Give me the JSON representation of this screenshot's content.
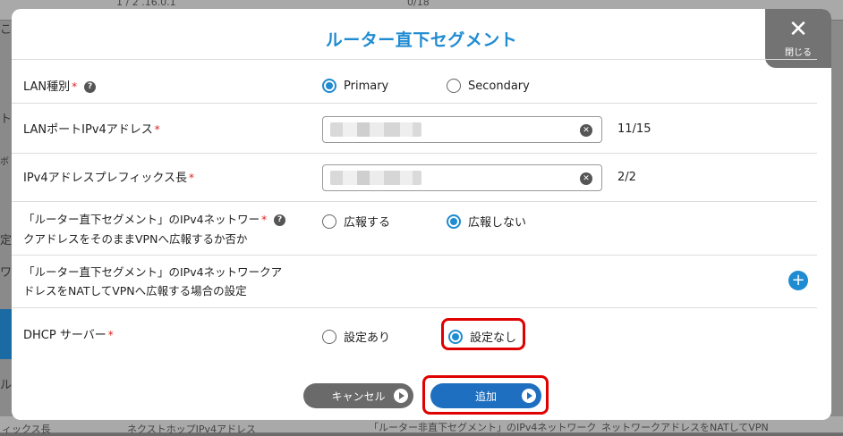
{
  "background": {
    "top_text": "0/18",
    "top_text_left": "1 / 2 .16.0.1",
    "bottom_texts": [
      "ィックス長",
      "ネクストホップIPv4アドレス",
      "「ルーター非直下セグメント」のIPv4ネットワーク",
      "ネットワークアドレスをNATしてVPN"
    ],
    "left_chars": [
      "こ",
      "ト",
      "ボ",
      "定",
      "ワ",
      "ル"
    ]
  },
  "modal": {
    "title": "ルーター直下セグメント",
    "close_icon": "close-icon",
    "close_label": "閉じる"
  },
  "form": {
    "lan_type": {
      "label": "LAN種別",
      "required": "*",
      "help": "?",
      "options": [
        "Primary",
        "Secondary"
      ],
      "selected": "Primary"
    },
    "lan_port_ipv4": {
      "label": "LANポートIPv4アドレス",
      "required": "*",
      "count": "11/15"
    },
    "ipv4_prefix": {
      "label": "IPv4アドレスプレフィックス長",
      "required": "*",
      "count": "2/2"
    },
    "advertise_vpn": {
      "label_line1": "「ルーター直下セグメント」のIPv4ネットワー",
      "label_line2": "クアドレスをそのままVPNへ広報するか否か",
      "required": "*",
      "help": "?",
      "options": [
        "広報する",
        "広報しない"
      ],
      "selected": "広報しない"
    },
    "nat_vpn": {
      "label_line1": "「ルーター直下セグメント」のIPv4ネットワークア",
      "label_line2": "ドレスをNATしてVPNへ広報する場合の設定",
      "add_icon": "+"
    },
    "dhcp": {
      "label": "DHCP サーバー",
      "required": "*",
      "options": [
        "設定あり",
        "設定なし"
      ],
      "selected": "設定なし"
    }
  },
  "footer": {
    "cancel_label": "キャンセル",
    "add_label": "追加"
  },
  "colors": {
    "accent": "#1f8bd1",
    "highlight": "#e00000",
    "cancel": "#6a6a6a"
  }
}
